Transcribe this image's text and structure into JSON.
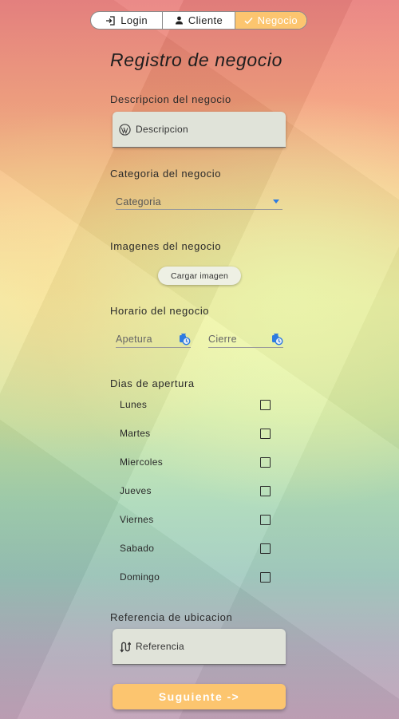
{
  "tabs": [
    {
      "label": "Login",
      "icon": "login-icon",
      "active": false
    },
    {
      "label": "Cliente",
      "icon": "person-icon",
      "active": false
    },
    {
      "label": "Negocio",
      "icon": "check-icon",
      "active": true
    }
  ],
  "page": {
    "title": "Registro de negocio"
  },
  "description": {
    "label": "Descripcion del negocio",
    "placeholder": "Descripcion",
    "icon": "wordpress-icon"
  },
  "category": {
    "label": "Categoria del negocio",
    "placeholder": "Categoria",
    "icon": "dropdown-caret-icon"
  },
  "images": {
    "label": "Imagenes del negocio",
    "button_label": "Cargar imagen"
  },
  "schedule": {
    "label": "Horario del negocio",
    "open_placeholder": "Apetura",
    "close_placeholder": "Cierre",
    "icon": "clock-icon"
  },
  "days": {
    "label": "Dias de apertura",
    "items": [
      "Lunes",
      "Martes",
      "Miercoles",
      "Jueves",
      "Viernes",
      "Sabado",
      "Domingo"
    ],
    "checked": [
      false,
      false,
      false,
      false,
      false,
      false,
      false
    ]
  },
  "location": {
    "label": "Referencia de ubicacion",
    "placeholder": "Referencia",
    "icon": "route-icon"
  },
  "footer": {
    "next_label": "Suguiente ->"
  },
  "colors": {
    "accent": "#fcc56f",
    "field_bg": "#e0e3d9",
    "icon_blue": "#2e7be0"
  }
}
